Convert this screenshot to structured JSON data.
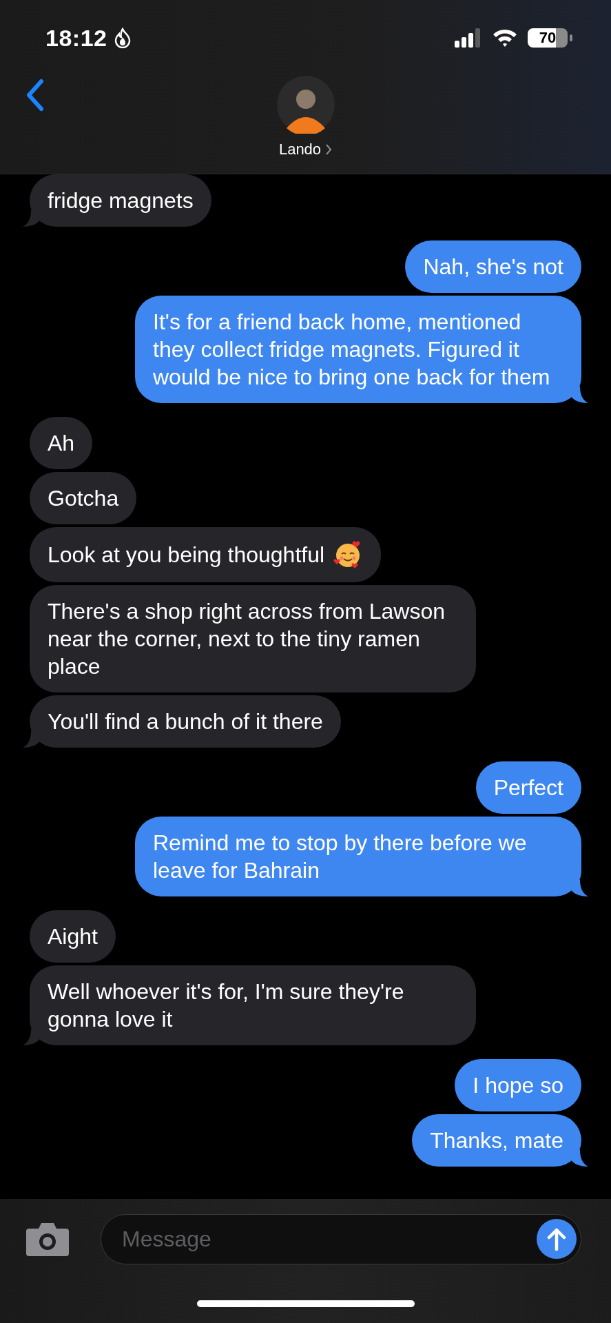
{
  "status_bar": {
    "time": "18:12",
    "battery": "70"
  },
  "header": {
    "contact": "Lando"
  },
  "groups": [
    {
      "kind": "incoming",
      "messages": [
        {
          "text": "fridge magnets",
          "kind": "plain"
        }
      ]
    },
    {
      "kind": "outgoing",
      "messages": [
        {
          "text": "Nah, she's not",
          "kind": "plain"
        },
        {
          "text": "It's for a friend back home, mentioned they collect fridge magnets. Figured it would be nice to bring one back for them",
          "kind": "plain"
        }
      ]
    },
    {
      "kind": "incoming",
      "messages": [
        {
          "text": "Ah",
          "kind": "plain"
        },
        {
          "text": "Gotcha",
          "kind": "plain"
        },
        {
          "text": "Look at you being thoughtful",
          "kind": "with-emoji"
        },
        {
          "text": "There's a shop right across from Lawson near the corner, next to the tiny ramen place",
          "kind": "plain"
        },
        {
          "text": "You'll find a bunch of it there",
          "kind": "plain"
        }
      ]
    },
    {
      "kind": "outgoing",
      "messages": [
        {
          "text": "Perfect",
          "kind": "plain"
        },
        {
          "text": "Remind me to stop by there before we leave for Bahrain",
          "kind": "plain"
        }
      ]
    },
    {
      "kind": "incoming",
      "messages": [
        {
          "text": "Aight",
          "kind": "plain"
        },
        {
          "text": "Well whoever it's for, I'm sure they're gonna love it",
          "kind": "plain"
        }
      ]
    },
    {
      "kind": "outgoing",
      "messages": [
        {
          "text": "I hope so",
          "kind": "plain"
        },
        {
          "text": "Thanks, mate",
          "kind": "plain"
        }
      ]
    }
  ],
  "composer": {
    "placeholder": "Message"
  }
}
